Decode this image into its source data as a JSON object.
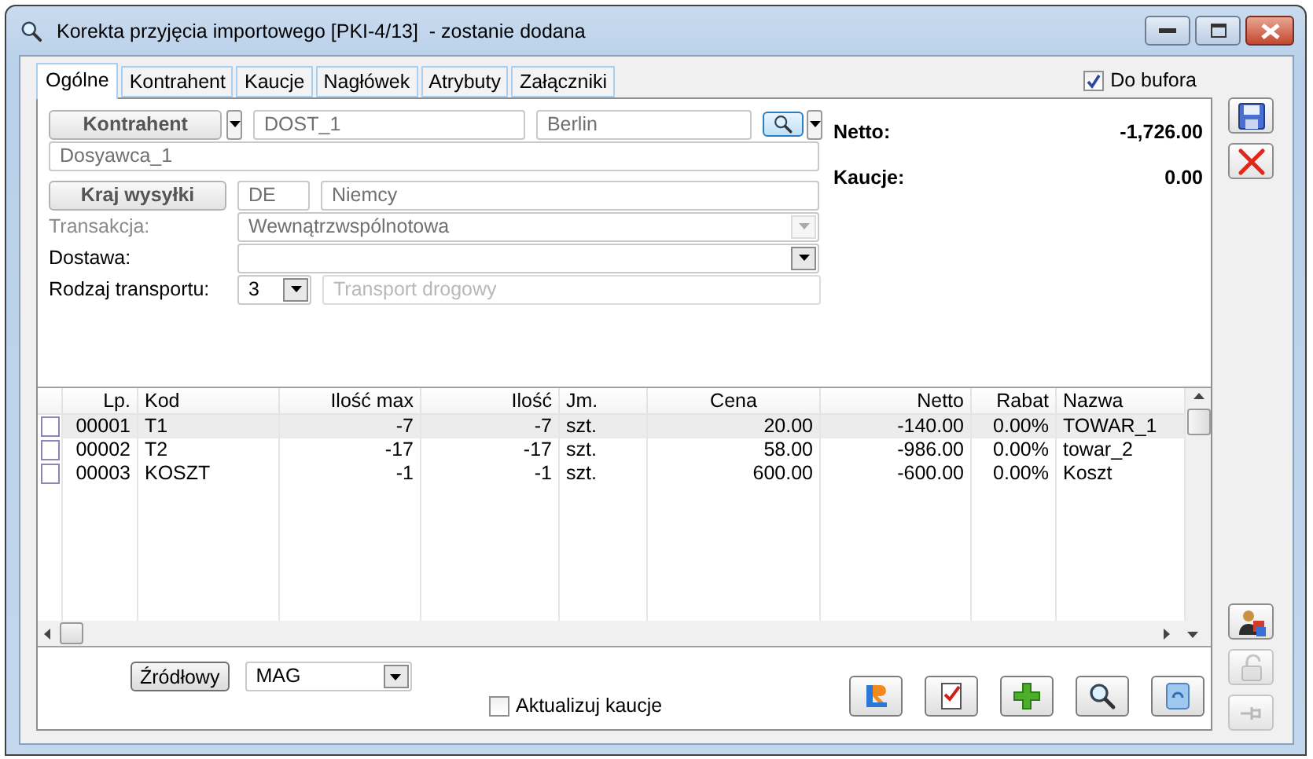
{
  "window": {
    "title": "Korekta przyjęcia importowego [PKI-4/13]  - zostanie dodana"
  },
  "tabs": [
    {
      "label": "Ogólne",
      "selected": true
    },
    {
      "label": "Kontrahent",
      "selected": false
    },
    {
      "label": "Kaucje",
      "selected": false
    },
    {
      "label": "Nagłówek",
      "selected": false
    },
    {
      "label": "Atrybuty",
      "selected": false
    },
    {
      "label": "Załączniki",
      "selected": false
    }
  ],
  "do_bufora": {
    "label": "Do bufora",
    "checked": true
  },
  "form": {
    "kontrahent_button": "Kontrahent",
    "kontrahent_code": "DOST_1",
    "kontrahent_city": "Berlin",
    "kontrahent_name": "Dosyawca_1",
    "kraj_button": "Kraj wysyłki",
    "kraj_code": "DE",
    "kraj_name": "Niemcy",
    "transakcja": {
      "label": "Transakcja:",
      "value": "Wewnątrzwspólnotowa",
      "disabled": true
    },
    "dostawa": {
      "label": "Dostawa:",
      "disabled": false
    },
    "transport": {
      "label": "Rodzaj transportu:",
      "code": "3",
      "name": "Transport drogowy",
      "name_disabled": true
    }
  },
  "summary": [
    {
      "label": "Netto:",
      "value": "-1,726.00"
    },
    {
      "label": "Kaucje:",
      "value": "0.00"
    }
  ],
  "table": {
    "columns": [
      "Lp.",
      "Kod",
      "Ilość max",
      "Ilość",
      "Jm.",
      "Cena",
      "Netto",
      "Rabat",
      "Nazwa"
    ],
    "rows": [
      {
        "selected": true,
        "checked": false,
        "cells": [
          "00001",
          "T1",
          "-7",
          "-7",
          "szt.",
          "20.00",
          "-140.00",
          "0.00%",
          "TOWAR_1"
        ]
      },
      {
        "selected": false,
        "checked": false,
        "cells": [
          "00002",
          "T2",
          "-17",
          "-17",
          "szt.",
          "58.00",
          "-986.00",
          "0.00%",
          "towar_2"
        ]
      },
      {
        "selected": false,
        "checked": false,
        "cells": [
          "00003",
          "KOSZT",
          "-1",
          "-1",
          "szt.",
          "600.00",
          "-600.00",
          "0.00%",
          "Koszt"
        ]
      }
    ]
  },
  "bottom": {
    "source_button": "Źródłowy",
    "warehouse": "MAG",
    "update_deposits": {
      "label": "Aktualizuj kaucje",
      "checked": false
    }
  },
  "toolbar": [
    {
      "kind": "logo"
    },
    {
      "kind": "document"
    },
    {
      "kind": "add"
    },
    {
      "kind": "search"
    },
    {
      "kind": "bin"
    }
  ],
  "side_top": [
    {
      "kind": "save",
      "disabled": false
    },
    {
      "kind": "cancel",
      "disabled": false
    }
  ],
  "side_bottom": [
    {
      "kind": "person",
      "disabled": false
    },
    {
      "kind": "lock",
      "disabled": true
    },
    {
      "kind": "pin",
      "disabled": true
    }
  ]
}
